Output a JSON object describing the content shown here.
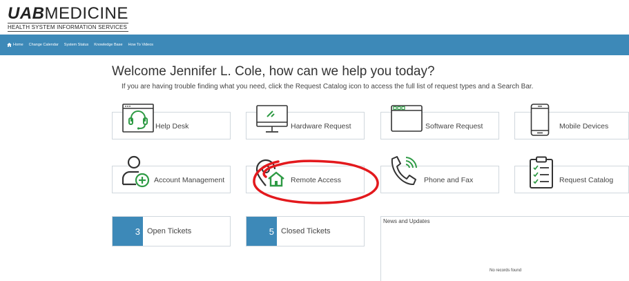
{
  "logo": {
    "brand_uab": "UAB",
    "brand_word": "MEDICINE",
    "subtitle": "HEALTH SYSTEM INFORMATION SERVICES"
  },
  "nav": {
    "items": [
      {
        "label": "Home",
        "icon": "home-icon"
      },
      {
        "label": "Change Calendar"
      },
      {
        "label": "System Status"
      },
      {
        "label": "Knowledge Base"
      },
      {
        "label": "How To Videos"
      }
    ]
  },
  "main": {
    "welcome": "Welcome Jennifer L. Cole, how can we help you today?",
    "instructions": "If you are having trouble finding what you need, click the Request Catalog icon to access the full list of request types and a Search Bar."
  },
  "tiles": [
    {
      "label": "Help Desk",
      "icon": "headset-icon"
    },
    {
      "label": "Hardware Request",
      "icon": "monitor-icon"
    },
    {
      "label": "Software Request",
      "icon": "app-window-icon"
    },
    {
      "label": "Mobile Devices",
      "icon": "smartphone-icon"
    },
    {
      "label": "Account Management",
      "icon": "add-user-icon"
    },
    {
      "label": "Remote Access",
      "icon": "remote-home-icon"
    },
    {
      "label": "Phone and Fax",
      "icon": "phone-icon"
    },
    {
      "label": "Request Catalog",
      "icon": "clipboard-checklist-icon"
    }
  ],
  "tickets": {
    "open": {
      "count": "3",
      "label": "Open Tickets"
    },
    "closed": {
      "count": "5",
      "label": "Closed Tickets"
    }
  },
  "news": {
    "title": "News and Updates",
    "empty": "No records found"
  },
  "colors": {
    "nav_bar": "#3d89b8",
    "icon_green": "#2e9a44",
    "annotation_red": "#e3191d"
  }
}
